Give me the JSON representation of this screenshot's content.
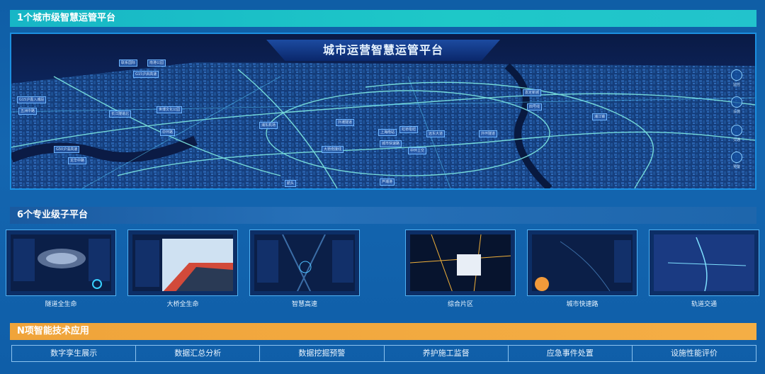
{
  "sections": {
    "level1": "1个城市级智慧运管平台",
    "level2": "6个专业级子平台",
    "level3": "N项智能技术应用"
  },
  "map": {
    "title": "城市运营智慧运管平台",
    "labels": [
      "联系国际",
      "南港公园",
      "G15沪启高速",
      "G15沪嘉入城段",
      "五洲中路",
      "长江隧道北",
      "世博文化公园",
      "中环路",
      "浦东机场",
      "外滩隧道",
      "上海南站",
      "虹桥枢纽",
      "G50沪渝高速",
      "龙华中路",
      "大桥南接线",
      "城市快速路",
      "中环立交",
      "远东大道",
      "外环隧道",
      "嘉定新城",
      "四号线",
      "浦江镇",
      "航头",
      "芦潮港"
    ],
    "side_buttons": [
      "监控",
      "设施",
      "交通",
      "预警"
    ]
  },
  "platforms": [
    {
      "name": "隧道全生命"
    },
    {
      "name": "大桥全生命"
    },
    {
      "name": "智慧高速"
    },
    {
      "name": "综合片区"
    },
    {
      "name": "城市快速路"
    },
    {
      "name": "轨道交通"
    }
  ],
  "tech_apps": [
    "数字孪生展示",
    "数据汇总分析",
    "数据挖掘预警",
    "养护施工监督",
    "应急事件处置",
    "设施性能评价"
  ],
  "colors": {
    "teal": "#1ec8c8",
    "orange": "#f4ae45",
    "frame": "#1c8fe0"
  }
}
